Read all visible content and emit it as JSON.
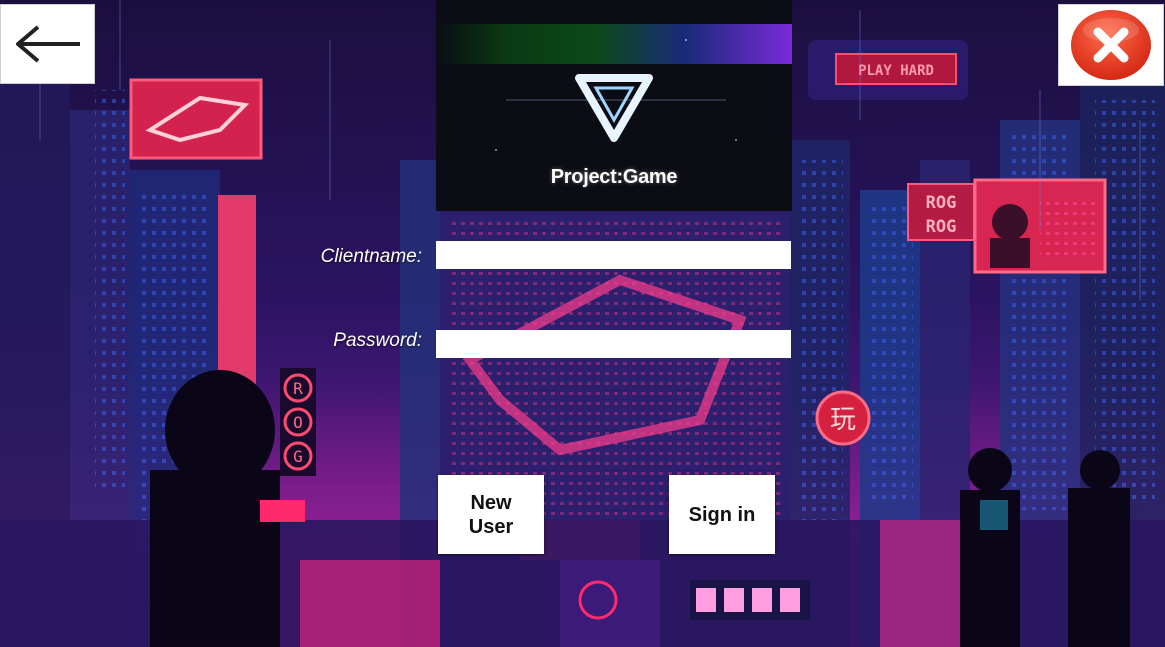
{
  "logo": {
    "title": "Project:Game"
  },
  "form": {
    "clientname_label": "Clientname:",
    "clientname_value": "",
    "password_label": "Password:",
    "password_value": ""
  },
  "buttons": {
    "new_user_line1": "New",
    "new_user_line2": "User",
    "sign_in": "Sign in"
  },
  "signs": {
    "play_hard": "PLAY HARD",
    "rog_1": "ROG",
    "rog_2": "ROG",
    "rog_vertical": [
      "R",
      "O",
      "G"
    ],
    "play_glyph": "玩"
  },
  "icons": {
    "back": "arrow-left-icon",
    "close": "close-icon",
    "logo": "triangle-logo-icon"
  },
  "colors": {
    "close_red": "#e8321e",
    "neon_pink": "#ff2a6d",
    "neon_blue": "#2fd0ff",
    "background": "#1a0b3a"
  }
}
